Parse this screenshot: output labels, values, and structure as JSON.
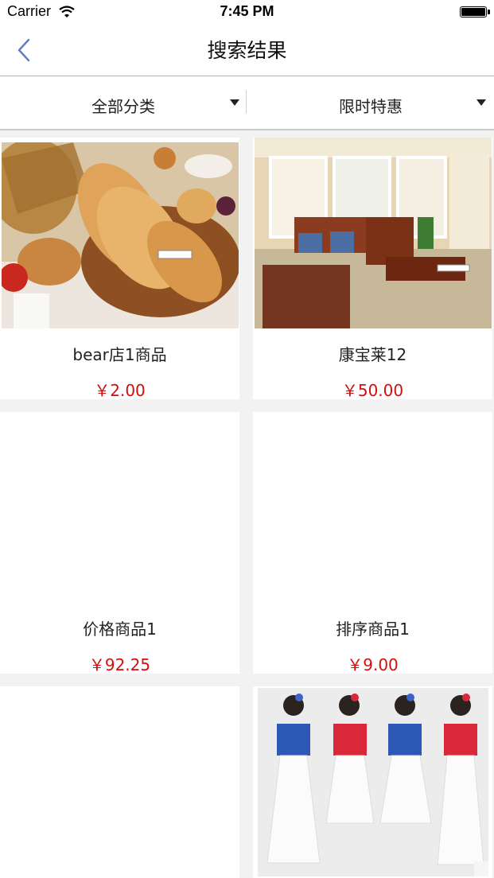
{
  "status_bar": {
    "carrier": "Carrier",
    "time": "7:45 PM"
  },
  "nav": {
    "title": "搜索结果"
  },
  "filters": {
    "category": "全部分类",
    "promotion": "限时特惠"
  },
  "products": [
    {
      "name": "bear店1商品",
      "price": "￥2.00",
      "image": "bread-photo"
    },
    {
      "name": "康宝莱12",
      "price": "￥50.00",
      "image": "living-room-photo"
    },
    {
      "name": "价格商品1",
      "price": "￥92.25",
      "image": ""
    },
    {
      "name": "排序商品1",
      "price": "￥9.00",
      "image": ""
    },
    {
      "name": "",
      "price": "",
      "image": ""
    },
    {
      "name": "",
      "price": "",
      "image": "dress-models-photo"
    }
  ],
  "colors": {
    "price": "#d40e0e",
    "back_arrow": "#5b7fc4",
    "background": "#f2f2f2"
  }
}
